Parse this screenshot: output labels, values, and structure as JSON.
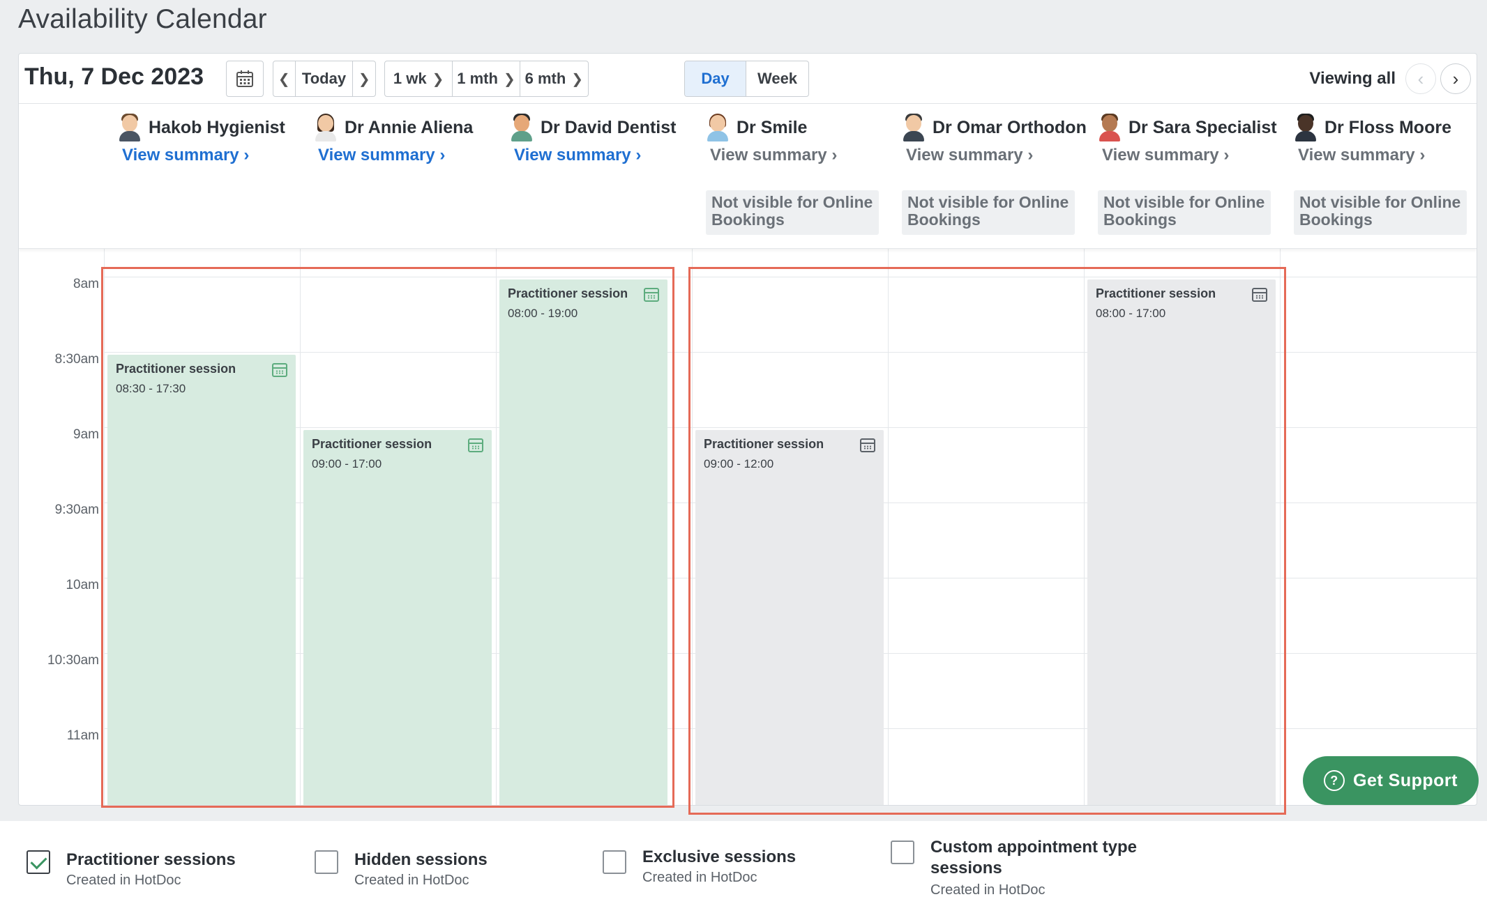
{
  "page": {
    "title": "Availability Calendar"
  },
  "toolbar": {
    "date": "Thu, 7 Dec 2023",
    "today": "Today",
    "one_week": "1 wk",
    "one_month": "1 mth",
    "six_month": "6 mth",
    "day": "Day",
    "week": "Week",
    "viewing": "Viewing all"
  },
  "practitioners": [
    {
      "name": "Hakob Hygienist",
      "summary": "View summary",
      "visible_online": true
    },
    {
      "name": "Dr Annie Aliena",
      "summary": "View summary",
      "visible_online": true
    },
    {
      "name": "Dr David Dentist",
      "summary": "View summary",
      "visible_online": true
    },
    {
      "name": "Dr Smile",
      "summary": "View summary",
      "visible_online": false,
      "note": "Not visible for Online Bookings"
    },
    {
      "name": "Dr Omar Orthodon",
      "summary": "View summary",
      "visible_online": false,
      "note": "Not visible for Online Bookings"
    },
    {
      "name": "Dr Sara Specialist",
      "summary": "View summary",
      "visible_online": false,
      "note": "Not visible for Online Bookings"
    },
    {
      "name": "Dr Floss Moore",
      "summary": "View summary",
      "visible_online": false,
      "note": "Not visible for Online Bookings"
    }
  ],
  "times": [
    "8am",
    "8:30am",
    "9am",
    "9:30am",
    "10am",
    "10:30am",
    "11am"
  ],
  "sessions": [
    {
      "title": "Practitioner session",
      "time": "08:30 - 17:30"
    },
    {
      "title": "Practitioner session",
      "time": "09:00 - 17:00"
    },
    {
      "title": "Practitioner session",
      "time": "08:00 - 19:00"
    },
    {
      "title": "Practitioner session",
      "time": "09:00 - 12:00"
    },
    {
      "title": "Practitioner session",
      "time": "08:00 - 17:00"
    }
  ],
  "support": {
    "label": "Get Support"
  },
  "legend": [
    {
      "title": "Practitioner sessions",
      "sub": "Created in HotDoc",
      "checked": true
    },
    {
      "title": "Hidden sessions",
      "sub": "Created in HotDoc",
      "checked": false
    },
    {
      "title": "Exclusive sessions",
      "sub": "Created in HotDoc",
      "checked": false
    },
    {
      "title": "Custom appointment type",
      "title2": "sessions",
      "sub": "Created in HotDoc",
      "checked": false
    }
  ],
  "colors": {
    "accent": "#1f6fd1",
    "session_visible": "#d7ebe0",
    "session_hidden": "#e9eaec",
    "highlight": "#e56a57",
    "support": "#3a9461"
  }
}
